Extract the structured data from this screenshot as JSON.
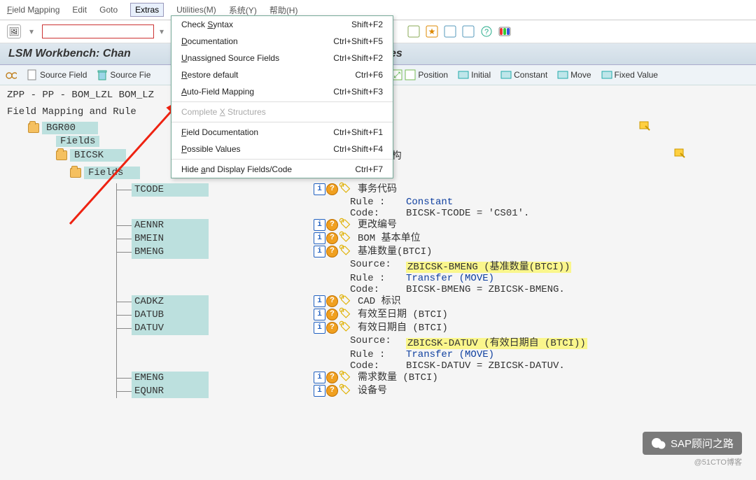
{
  "menu": {
    "field_mapping": "Field Mapping",
    "edit": "Edit",
    "goto": "Goto",
    "extras": "Extras",
    "utilities": "Utilities(M)",
    "system": "系统(Y)",
    "help": "帮助(H)"
  },
  "dropdown": [
    {
      "label": "Check Syntax",
      "shortcut": "Shift+F2",
      "u": "S"
    },
    {
      "label": "Documentation",
      "shortcut": "Ctrl+Shift+F5",
      "u": "D"
    },
    {
      "label": "Unassigned Source Fields",
      "shortcut": "Ctrl+Shift+F2",
      "u": "U"
    },
    {
      "label": "Restore default",
      "shortcut": "Ctrl+F6",
      "u": "R"
    },
    {
      "label": "Auto-Field Mapping",
      "shortcut": "Ctrl+Shift+F3",
      "u": "A"
    },
    {
      "label": "Complete X Structures",
      "shortcut": "",
      "u": "X",
      "disabled": true
    },
    {
      "label": "Field Documentation",
      "shortcut": "Ctrl+Shift+F1",
      "u": "F"
    },
    {
      "label": "Possible Values",
      "shortcut": "Ctrl+Shift+F4",
      "u": "P"
    },
    {
      "label": "Hide and Display Fields/Code",
      "shortcut": "Ctrl+F7",
      "u": "a"
    }
  ],
  "title_prefix": "LSM Workbench: Chan",
  "title_suffix": "on Rules",
  "toolbar": {
    "source_field": "Source Field",
    "source_fie": "Source Fie",
    "position": "Position",
    "initial": "Initial",
    "constant": "Constant",
    "move": "Move",
    "fixed_value": "Fixed Value"
  },
  "path": "ZPP - PP - BOM_LZL BOM_LZ",
  "heading": "Field Mapping and Rule",
  "tree": {
    "bgr00": "BGR00",
    "fields1": "Fields",
    "bicsk": "BICSK",
    "bicsk_desc": "BOM 表头数据的批输入结构",
    "fields2": "Fields"
  },
  "fields": [
    {
      "name": "TCODE",
      "desc": "事务代码",
      "sub": [
        {
          "k": "Rule :",
          "v": "Constant",
          "blue": true
        },
        {
          "k": "Code:",
          "v": "BICSK-TCODE = 'CS01'."
        }
      ]
    },
    {
      "name": "AENNR",
      "desc": "更改编号"
    },
    {
      "name": "BMEIN",
      "desc": "BOM 基本单位"
    },
    {
      "name": "BMENG",
      "desc": "基准数量(BTCI)",
      "sub": [
        {
          "k": "Source:",
          "v": "ZBICSK-BMENG (基准数量(BTCI))",
          "yellow": true
        },
        {
          "k": "Rule :",
          "v": "Transfer (MOVE)",
          "blue": true
        },
        {
          "k": "Code:",
          "v": "BICSK-BMENG = ZBICSK-BMENG."
        }
      ]
    },
    {
      "name": "CADKZ",
      "desc": "CAD 标识"
    },
    {
      "name": "DATUB",
      "desc": "有效至日期 (BTCI)"
    },
    {
      "name": "DATUV",
      "desc": "有效日期自 (BTCI)",
      "sub": [
        {
          "k": "Source:",
          "v": "ZBICSK-DATUV (有效日期自 (BTCI))",
          "yellow": true
        },
        {
          "k": "Rule :",
          "v": "Transfer (MOVE)",
          "blue": true
        },
        {
          "k": "Code:",
          "v": "BICSK-DATUV = ZBICSK-DATUV."
        }
      ]
    },
    {
      "name": "EMENG",
      "desc": "需求数量  (BTCI)"
    },
    {
      "name": "EQUNR",
      "desc": "设备号"
    }
  ],
  "watermark": {
    "main": "SAP顾问之路",
    "sub": "@51CTO博客"
  }
}
